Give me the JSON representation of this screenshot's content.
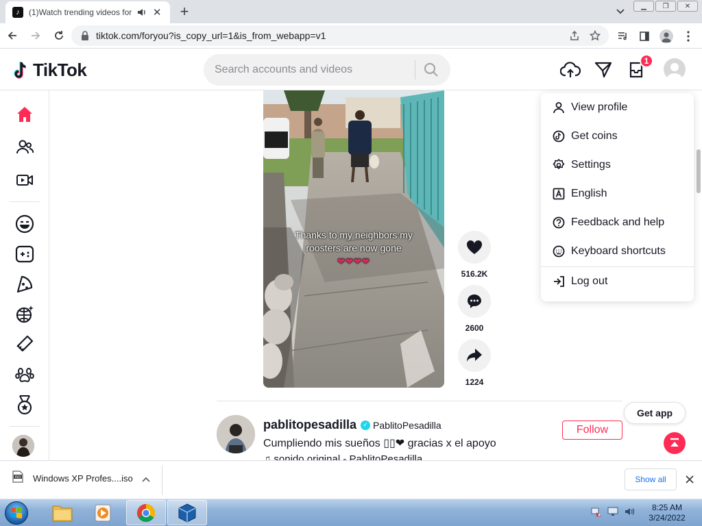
{
  "browser": {
    "tab_title": "(1)Watch trending videos for",
    "url": "tiktok.com/foryou?is_copy_url=1&is_from_webapp=v1"
  },
  "header": {
    "logo": "TikTok",
    "search_placeholder": "Search accounts and videos",
    "inbox_badge": "1"
  },
  "video": {
    "caption_line1": "Thanks to my neighbors my",
    "caption_line2": "roosters are now gone",
    "caption_emoji": "❤❤❤❤",
    "likes": "516.2K",
    "comments": "2600",
    "shares": "1224"
  },
  "post": {
    "username": "pablitopesadilla",
    "nickname": "PablitoPesadilla",
    "description": "Cumpliendo mis sueños ▯▯❤ gracias x el apoyo",
    "music": "♫ sonido original - PablitoPesadilla",
    "follow_label": "Follow"
  },
  "get_app": "Get app",
  "dropdown": {
    "items": [
      {
        "label": "View profile",
        "icon": "person-icon"
      },
      {
        "label": "Get coins",
        "icon": "coin-icon"
      },
      {
        "label": "Settings",
        "icon": "gear-icon"
      },
      {
        "label": "English",
        "icon": "language-icon"
      },
      {
        "label": "Feedback and help",
        "icon": "help-icon"
      },
      {
        "label": "Keyboard shortcuts",
        "icon": "keyboard-icon"
      },
      {
        "label": "Log out",
        "icon": "logout-icon"
      }
    ]
  },
  "download": {
    "filename": "Windows XP Profes....iso",
    "show_all": "Show all"
  },
  "taskbar": {
    "time": "8:25 AM",
    "date": "3/24/2022"
  },
  "colors": {
    "brand": "#fe2c55",
    "verified": "#20d5ec",
    "link_blue": "#1a73e8"
  }
}
